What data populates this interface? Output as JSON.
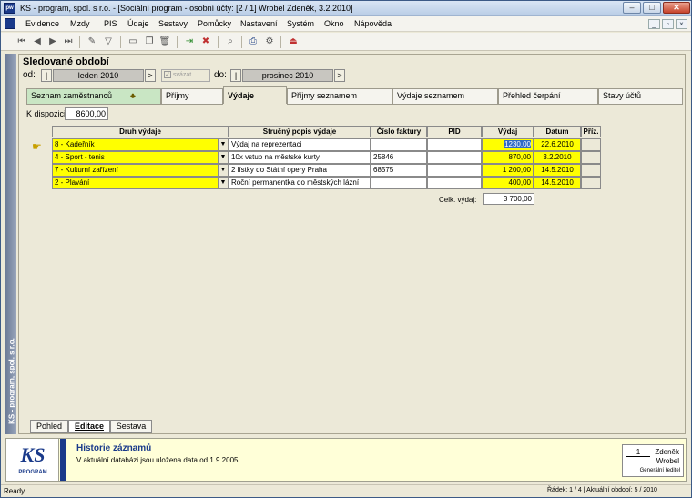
{
  "window": {
    "title": "KS - program, spol. s r.o. - [Sociální program - osobní účty: [2 / 1] Wrobel Zdeněk, 3.2.2010]",
    "app_icon_text": "pw",
    "buttons": {
      "min": "–",
      "max": "□",
      "close": "✕"
    }
  },
  "menu": {
    "items": [
      "Evidence",
      "Mzdy",
      "PIS",
      "Údaje",
      "Sestavy",
      "Pomůcky",
      "Nastavení",
      "Systém",
      "Okno",
      "Nápověda"
    ],
    "mdi": [
      "_",
      "▫",
      "×"
    ]
  },
  "toolbar": {
    "icons": [
      "first-icon",
      "prev-icon",
      "next-icon",
      "last-icon",
      "edit-icon",
      "filter-icon",
      "new-icon",
      "copy-icon",
      "delete-icon",
      "import-icon",
      "cancel-icon",
      "find-icon",
      "print-icon",
      "settings-icon",
      "exit-icon"
    ]
  },
  "sidestrip": {
    "label": "KS - program, spol. s r.o."
  },
  "section": {
    "title": "Sledované období"
  },
  "period": {
    "od_label": "od:",
    "do_label": "do:",
    "from": "leden 2010",
    "to": "prosinec 2010",
    "link_label": "svázat",
    "prev": "|",
    "next": ">"
  },
  "tabs": [
    "Seznam zaměstnanců",
    "Příjmy",
    "Výdaje",
    "Příjmy seznamem",
    "Výdaje seznamem",
    "Přehled čerpání",
    "Stavy účtů"
  ],
  "active_tab": "Výdaje",
  "k_dispozici": {
    "label": "K dispozici:",
    "value": "8600,00"
  },
  "table": {
    "headers": [
      "Druh výdaje",
      "Stručný popis výdaje",
      "Číslo faktury",
      "PID",
      "Výdaj",
      "Datum",
      "Příz."
    ],
    "rows": [
      {
        "druh": "8 - Kadeřník",
        "popis": "Výdaj na reprezentaci",
        "faktura": "",
        "pid": "",
        "vydaj": "1230,00",
        "datum": "22.6.2010",
        "priz": ""
      },
      {
        "druh": "4 - Sport - tenis",
        "popis": "10x vstup na městské kurty",
        "faktura": "25846",
        "pid": "",
        "vydaj": "870,00",
        "datum": "3.2.2010",
        "priz": ""
      },
      {
        "druh": "7 - Kulturní zařízení",
        "popis": "2 lístky do Státní opery Praha",
        "faktura": "68575",
        "pid": "",
        "vydaj": "1 200,00",
        "datum": "14.5.2010",
        "priz": ""
      },
      {
        "druh": "2 - Plavání",
        "popis": "Roční permanentka do městských lázní",
        "faktura": "",
        "pid": "",
        "vydaj": "400,00",
        "datum": "14.5.2010",
        "priz": ""
      }
    ],
    "total_label": "Celk. výdaj:",
    "total_value": "3 700,00"
  },
  "bottom_tabs": [
    "Pohled",
    "Editace",
    "Sestava"
  ],
  "active_bottom_tab": "Editace",
  "info": {
    "logo_text": "KS",
    "logo_sub": "PROGRAM",
    "title": "Historie záznamů",
    "text": "V aktuální databázi jsou uložena data od 1.9.2005.",
    "user_num": "1",
    "user_first": "Zdeněk",
    "user_last": "Wrobel",
    "user_role": "Generální ředitel"
  },
  "status": {
    "left": "Ready",
    "right": "Řádek: 1 / 4 | Aktuální období: 5 / 2010"
  },
  "colors": {
    "highlight": "#ffff00",
    "selection": "#316ac5",
    "brand": "#1a3a8a"
  }
}
